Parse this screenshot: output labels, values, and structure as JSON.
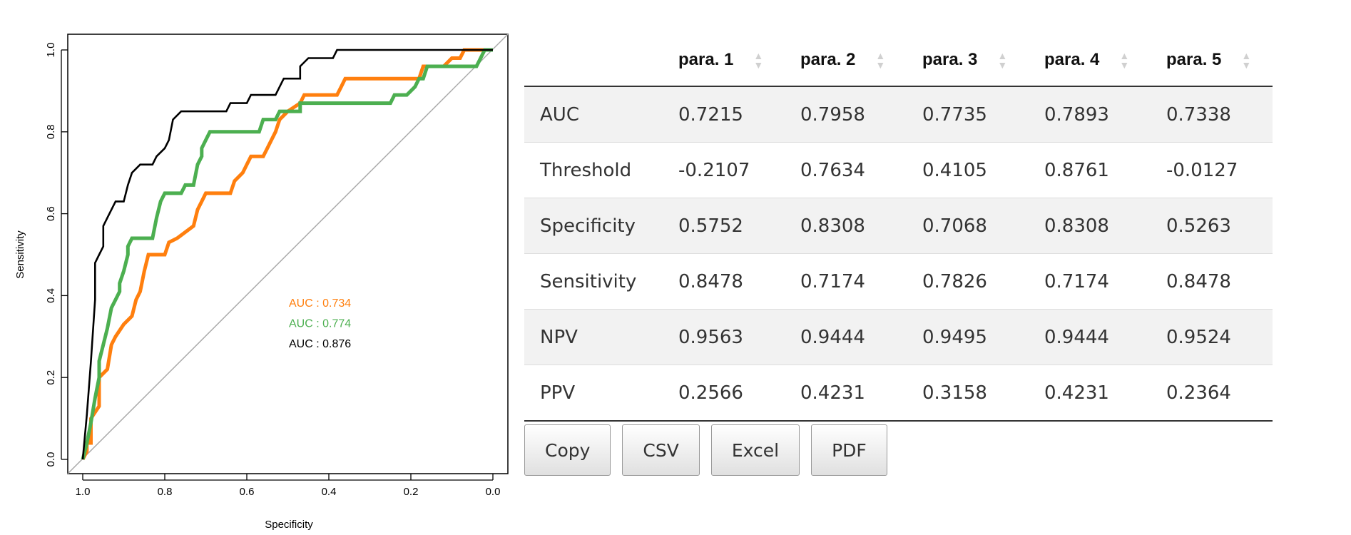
{
  "chart_data": {
    "type": "line",
    "xlabel": "Specificity",
    "ylabel": "Sensitivity",
    "xlim": [
      1.0,
      0.0
    ],
    "ylim": [
      0.0,
      1.0
    ],
    "x_ticks": [
      "1.0",
      "0.8",
      "0.6",
      "0.4",
      "0.2",
      "0.0"
    ],
    "y_ticks": [
      "0.0",
      "0.2",
      "0.4",
      "0.6",
      "0.8",
      "1.0"
    ],
    "series": [
      {
        "color": "#ff7f0e",
        "points": [
          [
            1.0,
            0.0
          ],
          [
            0.99,
            0.02
          ],
          [
            0.99,
            0.04
          ],
          [
            0.98,
            0.04
          ],
          [
            0.98,
            0.1
          ],
          [
            0.96,
            0.13
          ],
          [
            0.96,
            0.2
          ],
          [
            0.94,
            0.22
          ],
          [
            0.93,
            0.28
          ],
          [
            0.92,
            0.3
          ],
          [
            0.9,
            0.33
          ],
          [
            0.88,
            0.35
          ],
          [
            0.87,
            0.39
          ],
          [
            0.86,
            0.41
          ],
          [
            0.85,
            0.46
          ],
          [
            0.84,
            0.5
          ],
          [
            0.8,
            0.5
          ],
          [
            0.79,
            0.53
          ],
          [
            0.77,
            0.54
          ],
          [
            0.73,
            0.57
          ],
          [
            0.72,
            0.61
          ],
          [
            0.71,
            0.63
          ],
          [
            0.7,
            0.65
          ],
          [
            0.64,
            0.65
          ],
          [
            0.63,
            0.68
          ],
          [
            0.61,
            0.7
          ],
          [
            0.6,
            0.72
          ],
          [
            0.59,
            0.74
          ],
          [
            0.56,
            0.74
          ],
          [
            0.55,
            0.76
          ],
          [
            0.54,
            0.78
          ],
          [
            0.53,
            0.8
          ],
          [
            0.52,
            0.83
          ],
          [
            0.5,
            0.85
          ],
          [
            0.47,
            0.87
          ],
          [
            0.46,
            0.89
          ],
          [
            0.38,
            0.89
          ],
          [
            0.37,
            0.91
          ],
          [
            0.36,
            0.93
          ],
          [
            0.3,
            0.93
          ],
          [
            0.29,
            0.93
          ],
          [
            0.2,
            0.93
          ],
          [
            0.18,
            0.93
          ],
          [
            0.17,
            0.96
          ],
          [
            0.14,
            0.96
          ],
          [
            0.12,
            0.96
          ],
          [
            0.1,
            0.98
          ],
          [
            0.08,
            0.98
          ],
          [
            0.07,
            1.0
          ],
          [
            0.0,
            1.0
          ]
        ]
      },
      {
        "color": "#4caf50",
        "points": [
          [
            1.0,
            0.0
          ],
          [
            0.99,
            0.04
          ],
          [
            0.98,
            0.09
          ],
          [
            0.97,
            0.15
          ],
          [
            0.96,
            0.2
          ],
          [
            0.96,
            0.24
          ],
          [
            0.95,
            0.28
          ],
          [
            0.94,
            0.32
          ],
          [
            0.93,
            0.37
          ],
          [
            0.92,
            0.39
          ],
          [
            0.91,
            0.41
          ],
          [
            0.91,
            0.43
          ],
          [
            0.9,
            0.46
          ],
          [
            0.89,
            0.5
          ],
          [
            0.89,
            0.52
          ],
          [
            0.88,
            0.54
          ],
          [
            0.83,
            0.54
          ],
          [
            0.82,
            0.59
          ],
          [
            0.81,
            0.63
          ],
          [
            0.8,
            0.65
          ],
          [
            0.76,
            0.65
          ],
          [
            0.75,
            0.67
          ],
          [
            0.73,
            0.67
          ],
          [
            0.72,
            0.72
          ],
          [
            0.71,
            0.74
          ],
          [
            0.71,
            0.76
          ],
          [
            0.7,
            0.78
          ],
          [
            0.69,
            0.8
          ],
          [
            0.67,
            0.8
          ],
          [
            0.57,
            0.8
          ],
          [
            0.56,
            0.83
          ],
          [
            0.53,
            0.83
          ],
          [
            0.52,
            0.85
          ],
          [
            0.47,
            0.85
          ],
          [
            0.47,
            0.87
          ],
          [
            0.25,
            0.87
          ],
          [
            0.24,
            0.89
          ],
          [
            0.21,
            0.89
          ],
          [
            0.19,
            0.91
          ],
          [
            0.18,
            0.93
          ],
          [
            0.17,
            0.93
          ],
          [
            0.16,
            0.96
          ],
          [
            0.04,
            0.96
          ],
          [
            0.03,
            0.98
          ],
          [
            0.02,
            1.0
          ],
          [
            0.0,
            1.0
          ]
        ]
      },
      {
        "color": "#000000",
        "points": [
          [
            1.0,
            0.0
          ],
          [
            0.99,
            0.11
          ],
          [
            0.98,
            0.24
          ],
          [
            0.97,
            0.39
          ],
          [
            0.97,
            0.48
          ],
          [
            0.96,
            0.5
          ],
          [
            0.95,
            0.52
          ],
          [
            0.95,
            0.57
          ],
          [
            0.94,
            0.59
          ],
          [
            0.93,
            0.61
          ],
          [
            0.92,
            0.63
          ],
          [
            0.9,
            0.63
          ],
          [
            0.89,
            0.67
          ],
          [
            0.88,
            0.7
          ],
          [
            0.86,
            0.72
          ],
          [
            0.83,
            0.72
          ],
          [
            0.82,
            0.74
          ],
          [
            0.8,
            0.76
          ],
          [
            0.79,
            0.78
          ],
          [
            0.78,
            0.83
          ],
          [
            0.76,
            0.85
          ],
          [
            0.65,
            0.85
          ],
          [
            0.64,
            0.87
          ],
          [
            0.6,
            0.87
          ],
          [
            0.59,
            0.89
          ],
          [
            0.53,
            0.89
          ],
          [
            0.52,
            0.91
          ],
          [
            0.51,
            0.93
          ],
          [
            0.47,
            0.93
          ],
          [
            0.47,
            0.96
          ],
          [
            0.45,
            0.98
          ],
          [
            0.39,
            0.98
          ],
          [
            0.38,
            1.0
          ],
          [
            0.0,
            1.0
          ]
        ]
      }
    ],
    "annotations": [
      {
        "text": "AUC : 0.734",
        "color": "#ff7f0e"
      },
      {
        "text": "AUC : 0.774",
        "color": "#4caf50"
      },
      {
        "text": "AUC : 0.876",
        "color": "#000000"
      }
    ]
  },
  "table": {
    "headers": [
      "",
      "para. 1",
      "para. 2",
      "para. 3",
      "para. 4",
      "para. 5"
    ],
    "rows": [
      [
        "AUC",
        "0.7215",
        "0.7958",
        "0.7735",
        "0.7893",
        "0.7338"
      ],
      [
        "Threshold",
        "-0.2107",
        "0.7634",
        "0.4105",
        "0.8761",
        "-0.0127"
      ],
      [
        "Specificity",
        "0.5752",
        "0.8308",
        "0.7068",
        "0.8308",
        "0.5263"
      ],
      [
        "Sensitivity",
        "0.8478",
        "0.7174",
        "0.7826",
        "0.7174",
        "0.8478"
      ],
      [
        "NPV",
        "0.9563",
        "0.9444",
        "0.9495",
        "0.9444",
        "0.9524"
      ],
      [
        "PPV",
        "0.2566",
        "0.4231",
        "0.3158",
        "0.4231",
        "0.2364"
      ]
    ]
  },
  "buttons": {
    "copy": "Copy",
    "csv": "CSV",
    "excel": "Excel",
    "pdf": "PDF"
  }
}
